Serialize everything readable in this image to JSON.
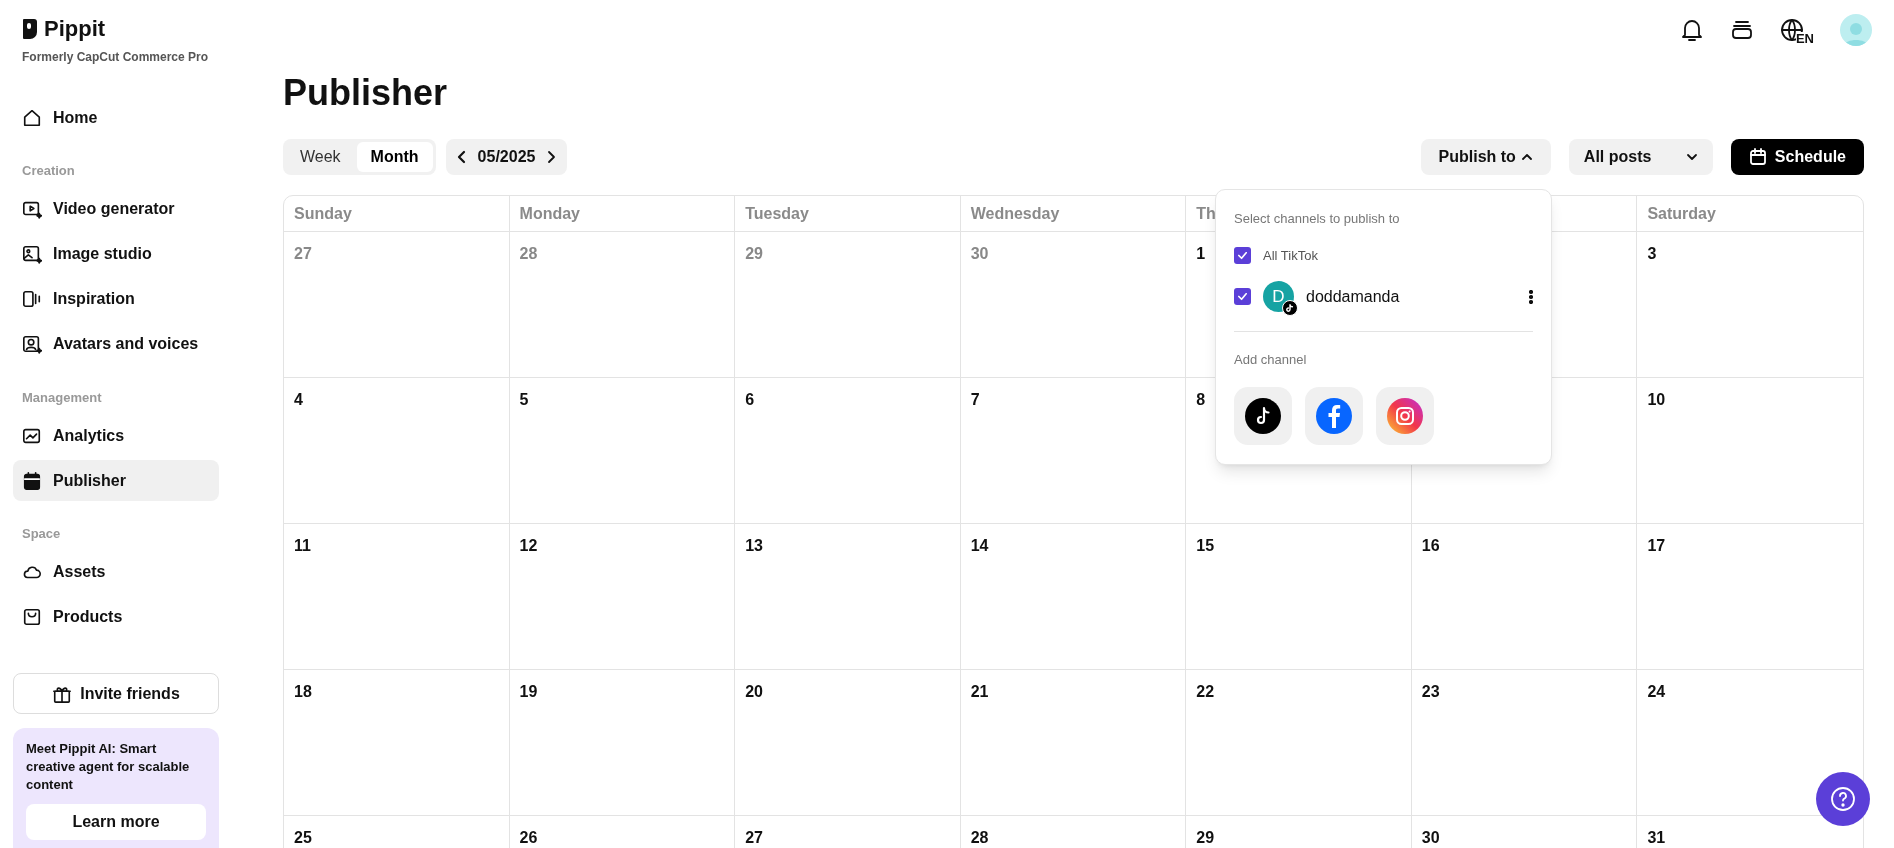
{
  "brand": {
    "name": "Pippit",
    "tagline": "Formerly CapCut Commerce Pro"
  },
  "sidebar": {
    "items": [
      {
        "kind": "item",
        "label": "Home",
        "selected": false
      },
      {
        "kind": "section",
        "label": "Creation"
      },
      {
        "kind": "item",
        "label": "Video generator",
        "selected": false
      },
      {
        "kind": "item",
        "label": "Image studio",
        "selected": false
      },
      {
        "kind": "item",
        "label": "Inspiration",
        "selected": false
      },
      {
        "kind": "item",
        "label": "Avatars and voices",
        "selected": false
      },
      {
        "kind": "section",
        "label": "Management"
      },
      {
        "kind": "item",
        "label": "Analytics",
        "selected": false
      },
      {
        "kind": "item",
        "label": "Publisher",
        "selected": true
      },
      {
        "kind": "section",
        "label": "Space"
      },
      {
        "kind": "item",
        "label": "Assets",
        "selected": false
      },
      {
        "kind": "item",
        "label": "Products",
        "selected": false
      }
    ],
    "invite_button": "Invite friends",
    "promo": {
      "text": "**Meet Pippit AI:** Smart creative agent for scalable content",
      "button": "Learn more"
    }
  },
  "header": {
    "language": "EN"
  },
  "page_title": "Publisher",
  "view_tabs": [
    {
      "label": "Week",
      "selected": false
    },
    {
      "label": "Month",
      "selected": true
    }
  ],
  "period": "05/2025",
  "publish_to": {
    "label": "Publish to",
    "expanded": true
  },
  "filter": {
    "value": "All posts"
  },
  "schedule_button": "Schedule",
  "calendar": {
    "columns": [
      {
        "label": "Sunday"
      },
      {
        "label": "Monday"
      },
      {
        "label": "Tuesday"
      },
      {
        "label": "Wednesday"
      },
      {
        "label": "Th"
      },
      {},
      {
        "label": "Saturday"
      }
    ],
    "weeks": [
      [
        {
          "kind": "day",
          "date": "27",
          "outside": true
        },
        {
          "kind": "day",
          "date": "28",
          "outside": true
        },
        {
          "kind": "day",
          "date": "29",
          "outside": true
        },
        {
          "kind": "day",
          "date": "30",
          "outside": true
        },
        {
          "kind": "day",
          "date": "1",
          "outside": false
        },
        {
          "kind": "covered"
        },
        {
          "kind": "day",
          "date": "3",
          "outside": false
        }
      ],
      [
        {
          "kind": "day",
          "date": "4",
          "outside": false
        },
        {
          "kind": "day",
          "date": "5",
          "outside": false
        },
        {
          "kind": "day",
          "date": "6",
          "outside": false
        },
        {
          "kind": "day",
          "date": "7",
          "outside": false
        },
        {
          "kind": "day",
          "date": "8",
          "outside": false
        },
        {
          "kind": "covered"
        },
        {
          "kind": "day",
          "date": "10",
          "outside": false
        }
      ],
      [
        {
          "kind": "day",
          "date": "11",
          "outside": false
        },
        {
          "kind": "day",
          "date": "12",
          "outside": false
        },
        {
          "kind": "day",
          "date": "13",
          "outside": false
        },
        {
          "kind": "day",
          "date": "14",
          "outside": false
        },
        {
          "kind": "day",
          "date": "15",
          "outside": false
        },
        {
          "kind": "day",
          "date": "16",
          "outside": false
        },
        {
          "kind": "day",
          "date": "17",
          "outside": false
        }
      ],
      [
        {
          "kind": "day",
          "date": "18",
          "outside": false
        },
        {
          "kind": "day",
          "date": "19",
          "outside": false
        },
        {
          "kind": "day",
          "date": "20",
          "outside": false
        },
        {
          "kind": "day",
          "date": "21",
          "outside": false
        },
        {
          "kind": "day",
          "date": "22",
          "outside": false
        },
        {
          "kind": "day",
          "date": "23",
          "outside": false
        },
        {
          "kind": "day",
          "date": "24",
          "outside": false
        }
      ],
      [
        {
          "kind": "day",
          "date": "25",
          "outside": false
        },
        {
          "kind": "day",
          "date": "26",
          "outside": false
        },
        {
          "kind": "day",
          "date": "27",
          "outside": false
        },
        {
          "kind": "day",
          "date": "28",
          "outside": false
        },
        {
          "kind": "day",
          "date": "29",
          "outside": false
        },
        {
          "kind": "day",
          "date": "30",
          "outside": false
        },
        {
          "kind": "day",
          "date": "31",
          "outside": false
        }
      ]
    ]
  },
  "channel_menu": {
    "heading": "Select channels to publish to",
    "channels": [
      {
        "kind": "group",
        "label": "All TikTok",
        "checked": true
      },
      {
        "kind": "account",
        "label": "doddamanda",
        "initial": "D",
        "checked": true
      }
    ],
    "add_heading": "Add channel"
  }
}
